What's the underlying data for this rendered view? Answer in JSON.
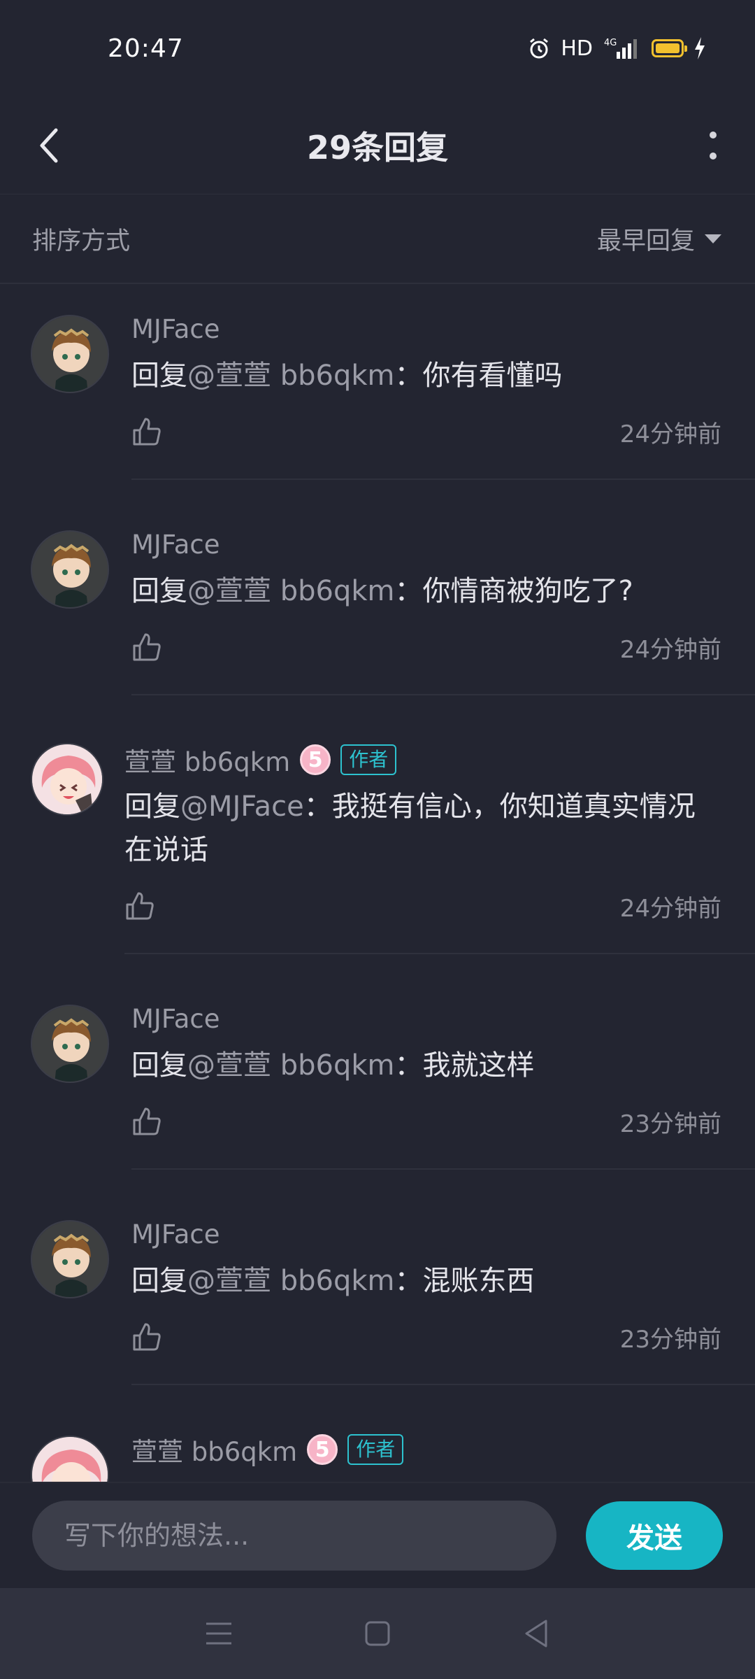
{
  "status_bar": {
    "time": "20:47",
    "hd": "HD",
    "network": "4G"
  },
  "header": {
    "title": "29条回复"
  },
  "sort": {
    "label": "排序方式",
    "value": "最早回复"
  },
  "replies": [
    {
      "user": "MJFace",
      "avatar": "mjface-avatar",
      "author": false,
      "level": "",
      "prefix": "回复",
      "mention": "@萱萱  bb6qkm",
      "message": "：你有看懂吗",
      "time": "24分钟前"
    },
    {
      "user": "MJFace",
      "avatar": "mjface-avatar",
      "author": false,
      "level": "",
      "prefix": "回复",
      "mention": "@萱萱  bb6qkm",
      "message": "：你情商被狗吃了?",
      "time": "24分钟前"
    },
    {
      "user": "萱萱  bb6qkm",
      "avatar": "xuanxuan-avatar",
      "author": true,
      "level": "5",
      "author_label": "作者",
      "prefix": "回复",
      "mention": "@MJFace",
      "message": "：我挺有信心，你知道真实情况在说话",
      "time": "24分钟前"
    },
    {
      "user": "MJFace",
      "avatar": "mjface-avatar",
      "author": false,
      "level": "",
      "prefix": "回复",
      "mention": "@萱萱  bb6qkm",
      "message": "：我就这样",
      "time": "23分钟前"
    },
    {
      "user": "MJFace",
      "avatar": "mjface-avatar",
      "author": false,
      "level": "",
      "prefix": "回复",
      "mention": "@萱萱  bb6qkm",
      "message": "：混账东西",
      "time": "23分钟前"
    },
    {
      "user": "萱萱  bb6qkm",
      "avatar": "xuanxuan-avatar",
      "author": true,
      "level": "5",
      "author_label": "作者",
      "prefix": "",
      "mention": "",
      "message": "",
      "time": ""
    }
  ],
  "composer": {
    "placeholder": "写下你的想法...",
    "send_label": "发送"
  },
  "colors": {
    "background": "#232531",
    "accent": "#17b5c4",
    "author_badge": "#2dc2cf"
  }
}
